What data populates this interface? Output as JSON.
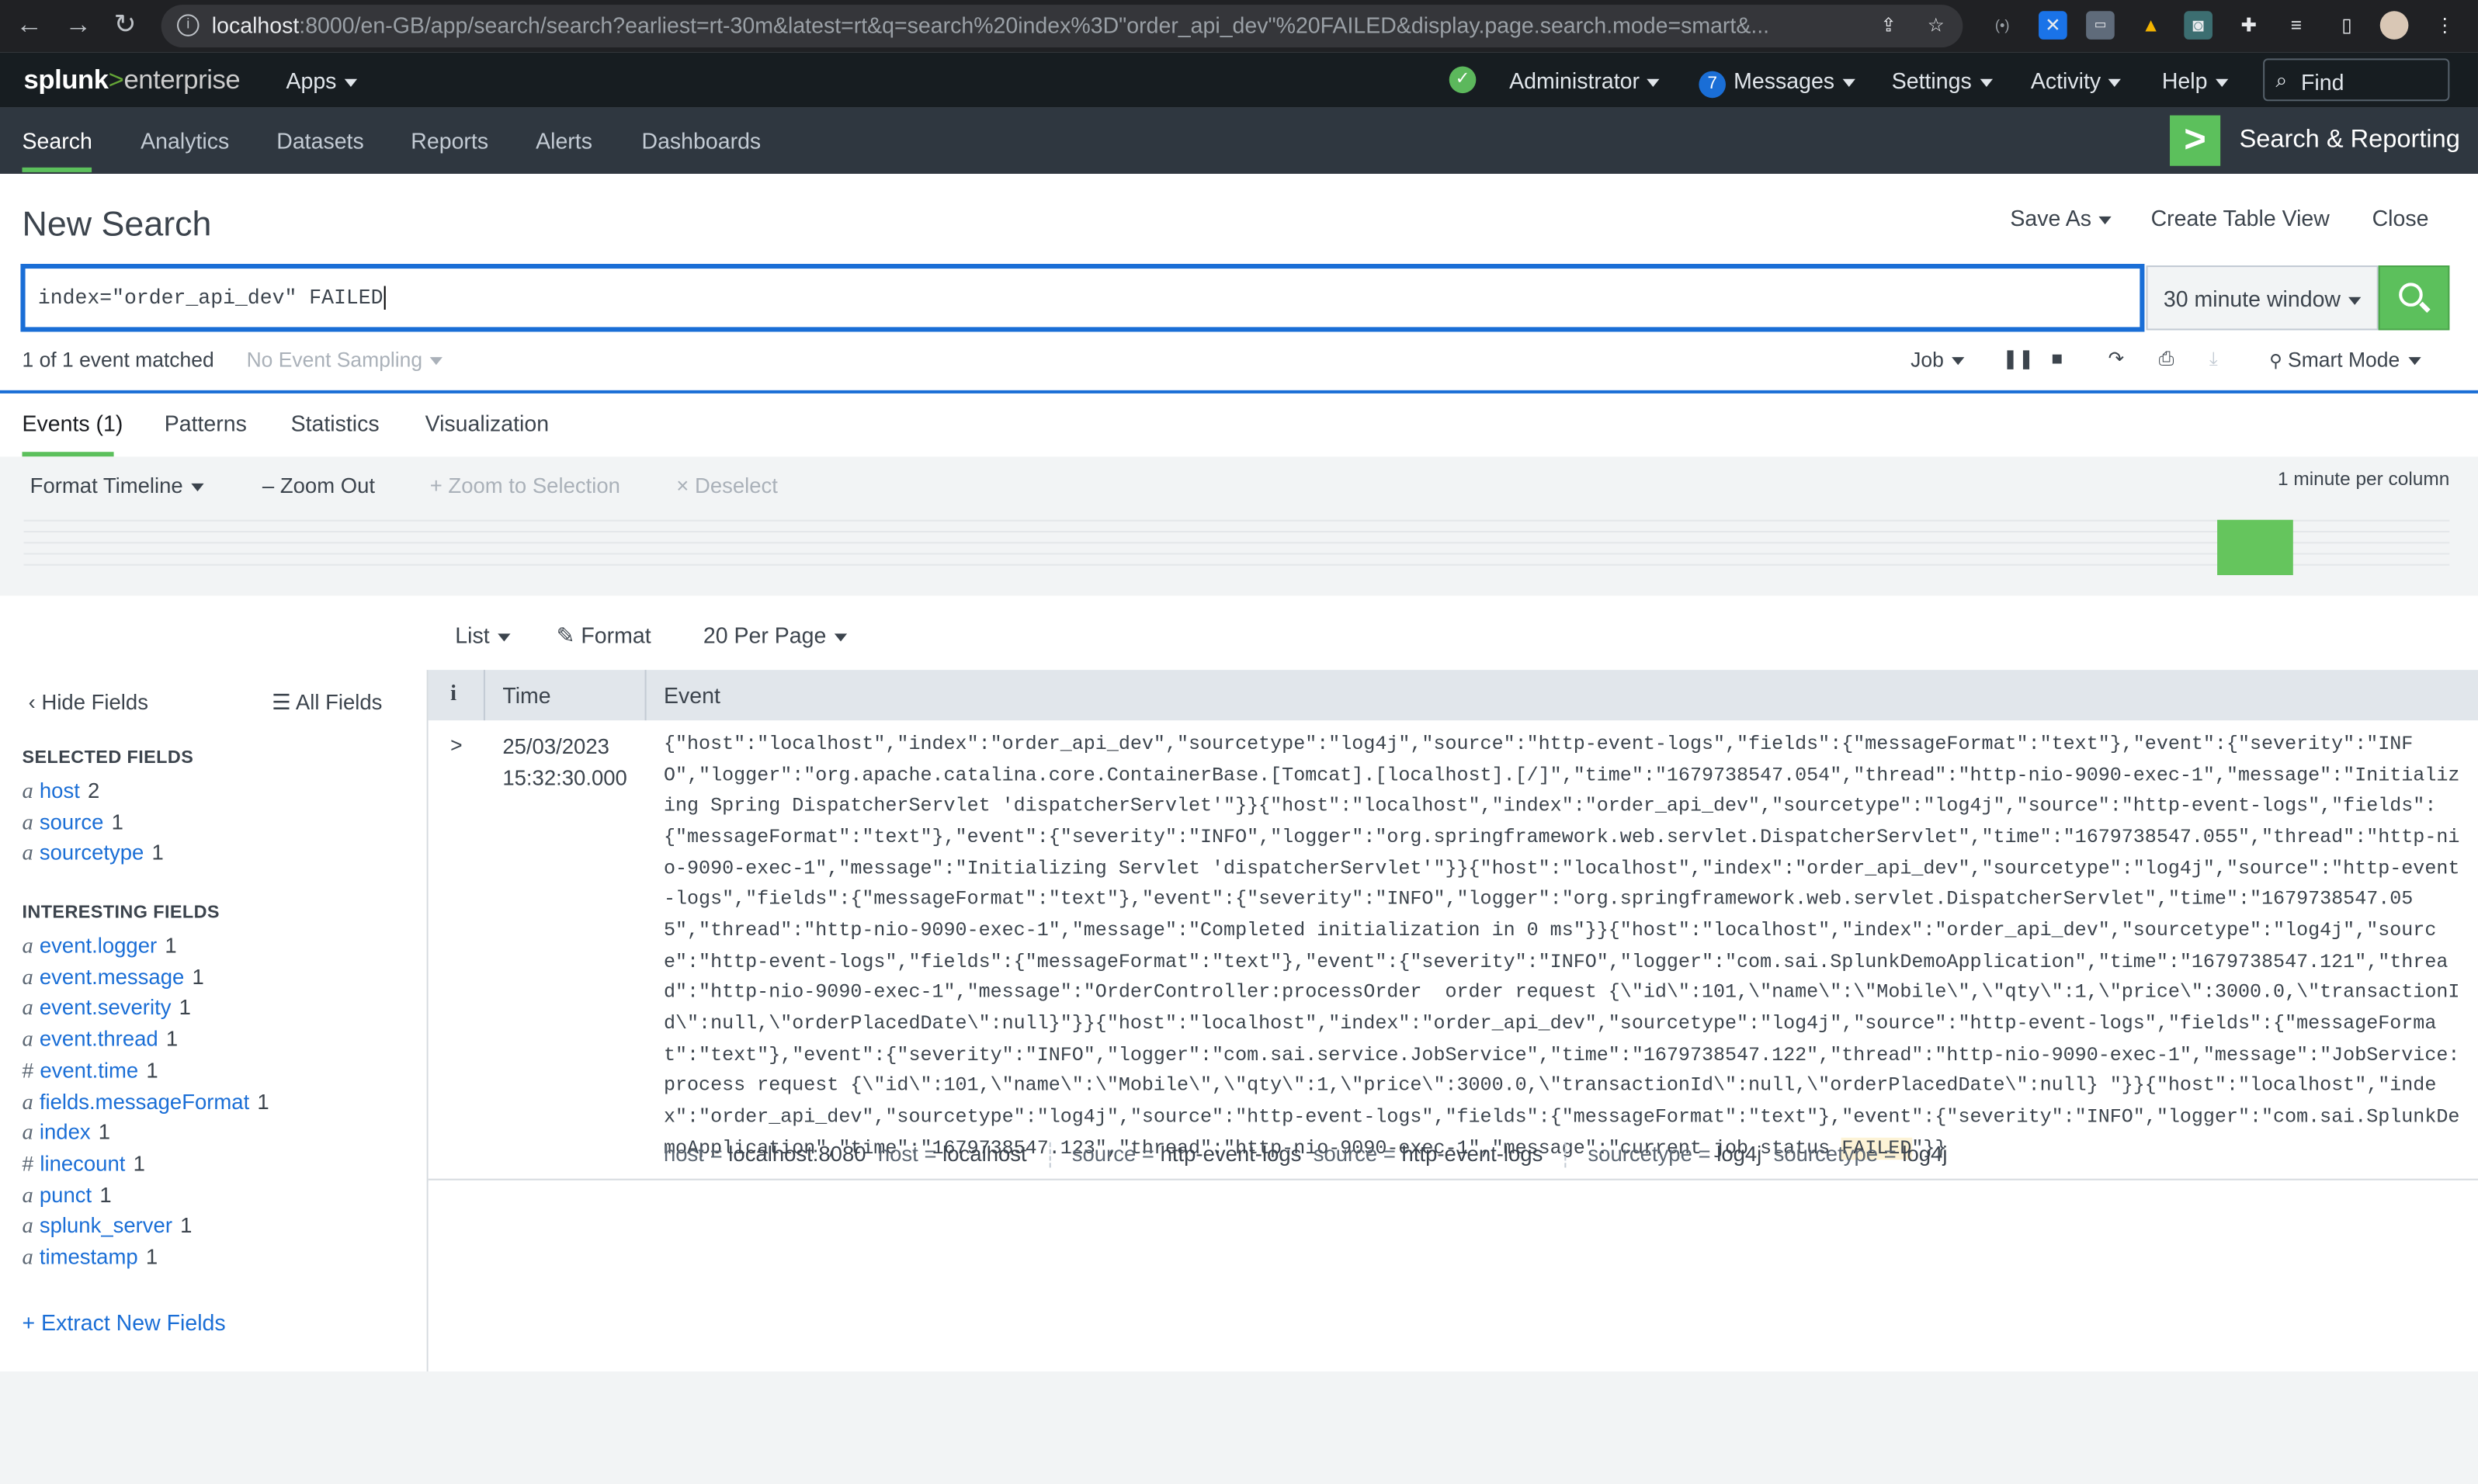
{
  "browser": {
    "url_host": "localhost",
    "url_rest": ":8000/en-GB/app/search/search?earliest=rt-30m&latest=rt&q=search%20index%3D\"order_api_dev\"%20FAILED&display.page.search.mode=smart&..."
  },
  "topbar": {
    "logo_splunk": "splunk",
    "logo_gt": ">",
    "logo_enterprise": "enterprise",
    "apps": "Apps",
    "user": "Administrator",
    "messages_count": "7",
    "messages": "Messages",
    "settings": "Settings",
    "activity": "Activity",
    "help": "Help",
    "find_placeholder": "Find"
  },
  "appbar": {
    "tabs": [
      "Search",
      "Analytics",
      "Datasets",
      "Reports",
      "Alerts",
      "Dashboards"
    ],
    "app_name": "Search & Reporting"
  },
  "header": {
    "title": "New Search",
    "save_as": "Save As",
    "create_table_view": "Create Table View",
    "close": "Close"
  },
  "search": {
    "query": "index=\"order_api_dev\" FAILED",
    "time_range": "30 minute window"
  },
  "status": {
    "matched": "1 of 1 event matched",
    "sampling": "No Event Sampling",
    "job": "Job",
    "mode": "Smart Mode"
  },
  "result_tabs": [
    "Events (1)",
    "Patterns",
    "Statistics",
    "Visualization"
  ],
  "timeline": {
    "format": "Format Timeline",
    "zoom_out": "Zoom Out",
    "zoom_selection": "Zoom to Selection",
    "deselect": "Deselect",
    "scale": "1 minute per column"
  },
  "list_controls": {
    "list": "List",
    "format": "Format",
    "per_page": "20 Per Page"
  },
  "sidebar": {
    "hide_fields": "Hide Fields",
    "all_fields": "All Fields",
    "selected_heading": "SELECTED FIELDS",
    "selected": [
      {
        "type": "a",
        "name": "host",
        "count": "2"
      },
      {
        "type": "a",
        "name": "source",
        "count": "1"
      },
      {
        "type": "a",
        "name": "sourcetype",
        "count": "1"
      }
    ],
    "interesting_heading": "INTERESTING FIELDS",
    "interesting": [
      {
        "type": "a",
        "name": "event.logger",
        "count": "1"
      },
      {
        "type": "a",
        "name": "event.message",
        "count": "1"
      },
      {
        "type": "a",
        "name": "event.severity",
        "count": "1"
      },
      {
        "type": "a",
        "name": "event.thread",
        "count": "1"
      },
      {
        "type": "#",
        "name": "event.time",
        "count": "1"
      },
      {
        "type": "a",
        "name": "fields.messageFormat",
        "count": "1"
      },
      {
        "type": "a",
        "name": "index",
        "count": "1"
      },
      {
        "type": "#",
        "name": "linecount",
        "count": "1"
      },
      {
        "type": "a",
        "name": "punct",
        "count": "1"
      },
      {
        "type": "a",
        "name": "splunk_server",
        "count": "1"
      },
      {
        "type": "a",
        "name": "timestamp",
        "count": "1"
      }
    ],
    "extract": "+ Extract New Fields"
  },
  "table": {
    "info_col": "i",
    "time_col": "Time",
    "event_col": "Event",
    "event": {
      "date": "25/03/2023",
      "time": "15:32:30.000",
      "text_before": "{\"host\":\"localhost\",\"index\":\"order_api_dev\",\"sourcetype\":\"log4j\",\"source\":\"http-event-logs\",\"fields\":{\"messageFormat\":\"text\"},\"event\":{\"severity\":\"INFO\",\"logger\":\"org.apache.catalina.core.ContainerBase.[Tomcat].[localhost].[/]\",\"time\":\"1679738547.054\",\"thread\":\"http-nio-9090-exec-1\",\"message\":\"Initializing Spring DispatcherServlet 'dispatcherServlet'\"}}{\"host\":\"localhost\",\"index\":\"order_api_dev\",\"sourcetype\":\"log4j\",\"source\":\"http-event-logs\",\"fields\":{\"messageFormat\":\"text\"},\"event\":{\"severity\":\"INFO\",\"logger\":\"org.springframework.web.servlet.DispatcherServlet\",\"time\":\"1679738547.055\",\"thread\":\"http-nio-9090-exec-1\",\"message\":\"Initializing Servlet 'dispatcherServlet'\"}}{\"host\":\"localhost\",\"index\":\"order_api_dev\",\"sourcetype\":\"log4j\",\"source\":\"http-event-logs\",\"fields\":{\"messageFormat\":\"text\"},\"event\":{\"severity\":\"INFO\",\"logger\":\"org.springframework.web.servlet.DispatcherServlet\",\"time\":\"1679738547.055\",\"thread\":\"http-nio-9090-exec-1\",\"message\":\"Completed initialization in 0 ms\"}}{\"host\":\"localhost\",\"index\":\"order_api_dev\",\"sourcetype\":\"log4j\",\"source\":\"http-event-logs\",\"fields\":{\"messageFormat\":\"text\"},\"event\":{\"severity\":\"INFO\",\"logger\":\"com.sai.SplunkDemoApplication\",\"time\":\"1679738547.121\",\"thread\":\"http-nio-9090-exec-1\",\"message\":\"OrderController:processOrder  order request {\\\"id\\\":101,\\\"name\\\":\\\"Mobile\\\",\\\"qty\\\":1,\\\"price\\\":3000.0,\\\"transactionId\\\":null,\\\"orderPlacedDate\\\":null}\"}}{\"host\":\"localhost\",\"index\":\"order_api_dev\",\"sourcetype\":\"log4j\",\"source\":\"http-event-logs\",\"fields\":{\"messageFormat\":\"text\"},\"event\":{\"severity\":\"INFO\",\"logger\":\"com.sai.service.JobService\",\"time\":\"1679738547.122\",\"thread\":\"http-nio-9090-exec-1\",\"message\":\"JobService:process request {\\\"id\\\":101,\\\"name\\\":\\\"Mobile\\\",\\\"qty\\\":1,\\\"price\\\":3000.0,\\\"transactionId\\\":null,\\\"orderPlacedDate\\\":null} \"}}{\"host\":\"localhost\",\"index\":\"order_api_dev\",\"sourcetype\":\"log4j\",\"source\":\"http-event-logs\",\"fields\":{\"messageFormat\":\"text\"},\"event\":{\"severity\":\"INFO\",\"logger\":\"com.sai.SplunkDemoApplication\",\"time\":\"1679738547.123\",\"thread\":\"http-nio-9090-exec-1\",\"message\":\"current job status ",
      "highlight": "FAILED",
      "text_after": "\"}}",
      "fields": [
        {
          "key": "host =",
          "value": "localhost:8080"
        },
        {
          "key": "host =",
          "value": "localhost"
        },
        {
          "key": "source =",
          "value": "http-event-logs"
        },
        {
          "key": "source =",
          "value": "http-event-logs"
        },
        {
          "key": "sourcetype =",
          "value": "log4j"
        },
        {
          "key": "sourcetype =",
          "value": "log4j"
        }
      ]
    }
  }
}
